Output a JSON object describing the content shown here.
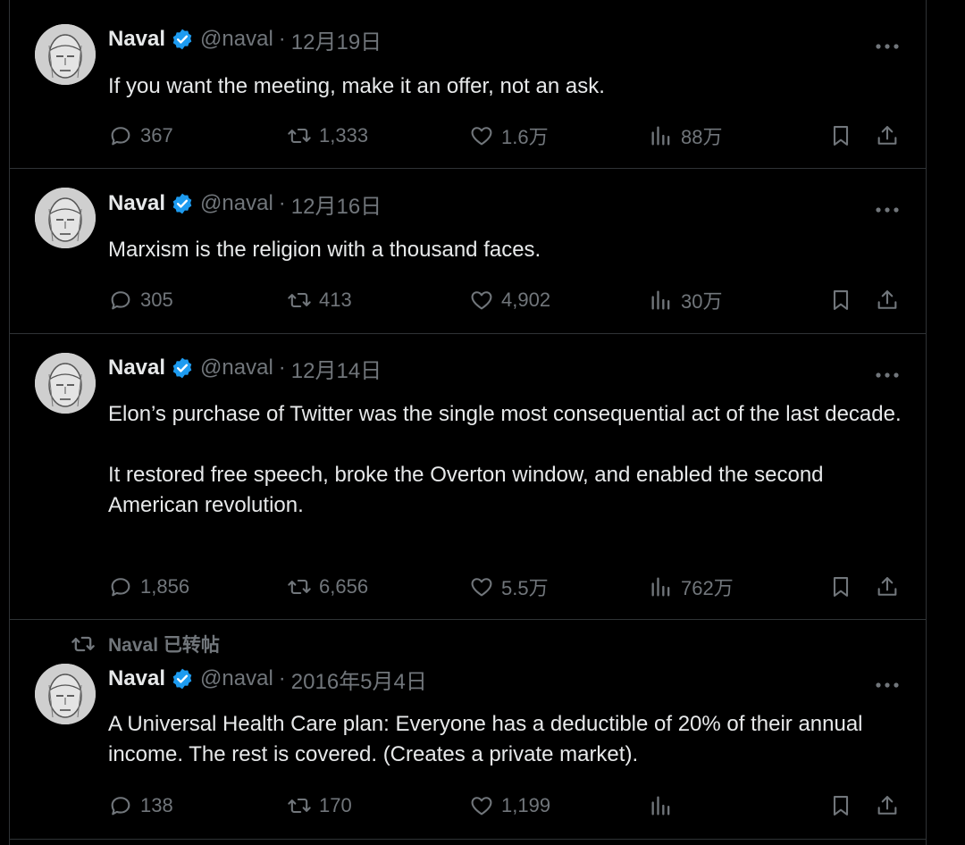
{
  "tweets": [
    {
      "name": "Naval",
      "handle": "@naval",
      "separator": "·",
      "date": "12月19日",
      "text": [
        "If you want the meeting, make it an offer, not an ask."
      ],
      "replies": "367",
      "retweets": "1,333",
      "likes": "1.6万",
      "views": "88万"
    },
    {
      "name": "Naval",
      "handle": "@naval",
      "separator": "·",
      "date": "12月16日",
      "text": [
        "Marxism is the religion with a thousand faces."
      ],
      "replies": "305",
      "retweets": "413",
      "likes": "4,902",
      "views": "30万"
    },
    {
      "name": "Naval",
      "handle": "@naval",
      "separator": "·",
      "date": "12月14日",
      "text": [
        "Elon’s purchase of Twitter was the single most consequential act of the last decade.",
        "It restored free speech, broke the Overton window, and enabled the second American revolution."
      ],
      "replies": "1,856",
      "retweets": "6,656",
      "likes": "5.5万",
      "views": "762万"
    },
    {
      "retweeted_by": "Naval 已转帖",
      "name": "Naval",
      "handle": "@naval",
      "separator": "·",
      "date": "2016年5月4日",
      "text": [
        "A Universal Health Care plan: Everyone has a deductible of 20% of their annual income. The rest is covered. (Creates a private market)."
      ],
      "replies": "138",
      "retweets": "170",
      "likes": "1,199",
      "views": ""
    }
  ],
  "icons": {
    "verified": "verified-badge-icon",
    "more": "more-horizontal-icon",
    "reply": "reply-bubble-icon",
    "retweet": "retweet-icon",
    "like": "heart-icon",
    "views": "analytics-bars-icon",
    "bookmark": "bookmark-icon",
    "share": "share-upload-icon"
  },
  "colors": {
    "background": "#000000",
    "text": "#e7e9ea",
    "muted": "#71767b",
    "verified": "#1d9bf0",
    "border": "#2f3336"
  }
}
